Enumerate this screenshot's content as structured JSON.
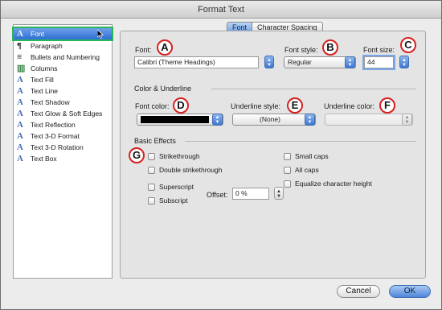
{
  "window": {
    "title": "Format Text"
  },
  "sidebar": {
    "items": [
      {
        "label": "Font",
        "icon": "font-icon",
        "glyph": "A"
      },
      {
        "label": "Paragraph",
        "icon": "paragraph-icon",
        "glyph": "¶"
      },
      {
        "label": "Bullets and Numbering",
        "icon": "bullets-icon",
        "glyph": "≡"
      },
      {
        "label": "Columns",
        "icon": "columns-icon",
        "glyph": "▥"
      },
      {
        "label": "Text Fill",
        "icon": "text-fill-icon",
        "glyph": "A"
      },
      {
        "label": "Text Line",
        "icon": "text-line-icon",
        "glyph": "A"
      },
      {
        "label": "Text Shadow",
        "icon": "text-shadow-icon",
        "glyph": "A"
      },
      {
        "label": "Text Glow & Soft Edges",
        "icon": "text-glow-icon",
        "glyph": "A"
      },
      {
        "label": "Text Reflection",
        "icon": "text-reflection-icon",
        "glyph": "A"
      },
      {
        "label": "Text 3-D Format",
        "icon": "text-3d-format-icon",
        "glyph": "A"
      },
      {
        "label": "Text 3-D Rotation",
        "icon": "text-3d-rotation-icon",
        "glyph": "A"
      },
      {
        "label": "Text Box",
        "icon": "text-box-icon",
        "glyph": "A"
      }
    ]
  },
  "tabs": {
    "font": "Font",
    "character_spacing": "Character Spacing"
  },
  "font": {
    "label": "Font:",
    "value": "Calibri (Theme Headings)",
    "style_label": "Font style:",
    "style_value": "Regular",
    "size_label": "Font size:",
    "size_value": "44"
  },
  "color_underline": {
    "title": "Color & Underline",
    "font_color_label": "Font color:",
    "font_color": "#000000",
    "underline_style_label": "Underline style:",
    "underline_style_value": "(None)",
    "underline_color_label": "Underline color:"
  },
  "effects": {
    "title": "Basic Effects",
    "strikethrough": "Strikethrough",
    "double_strikethrough": "Double strikethrough",
    "superscript": "Superscript",
    "subscript": "Subscript",
    "offset_label": "Offset:",
    "offset_value": "0 %",
    "small_caps": "Small caps",
    "all_caps": "All caps",
    "equalize": "Equalize character height"
  },
  "badges": {
    "a": "A",
    "b": "B",
    "c": "C",
    "d": "D",
    "e": "E",
    "f": "F",
    "g": "G"
  },
  "buttons": {
    "cancel": "Cancel",
    "ok": "OK"
  },
  "colors": {
    "badge_border": "#d62020",
    "selection_outline": "#2cb457",
    "accent_blue": "#4f86d8"
  }
}
